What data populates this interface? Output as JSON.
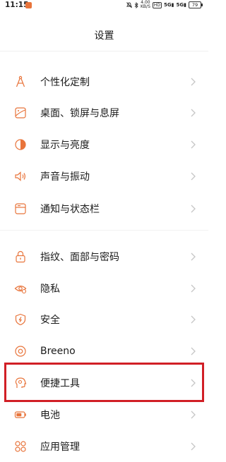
{
  "status_bar": {
    "time": "11:15",
    "net_speed_top": "4.00",
    "net_speed_bottom": "KB/S",
    "hd_label": "HD",
    "signal_1": "5G",
    "signal_2": "5G",
    "battery": "79"
  },
  "header": {
    "title": "设置"
  },
  "settings": {
    "group1": [
      {
        "label": "个性化定制",
        "icon": "compass-icon"
      },
      {
        "label": "桌面、锁屏与息屏",
        "icon": "wallpaper-icon"
      },
      {
        "label": "显示与亮度",
        "icon": "brightness-icon"
      },
      {
        "label": "声音与振动",
        "icon": "speaker-icon"
      },
      {
        "label": "通知与状态栏",
        "icon": "notification-icon"
      }
    ],
    "group2": [
      {
        "label": "指纹、面部与密码",
        "icon": "lock-icon"
      },
      {
        "label": "隐私",
        "icon": "privacy-eye-icon"
      },
      {
        "label": "安全",
        "icon": "shield-icon"
      },
      {
        "label": "Breeno",
        "icon": "breeno-icon"
      },
      {
        "label": "便捷工具",
        "icon": "convenience-tools-icon"
      },
      {
        "label": "电池",
        "icon": "battery-icon"
      },
      {
        "label": "应用管理",
        "icon": "app-grid-icon"
      }
    ]
  },
  "colors": {
    "accent": "#e8743b",
    "highlight_border": "#d11f26"
  }
}
